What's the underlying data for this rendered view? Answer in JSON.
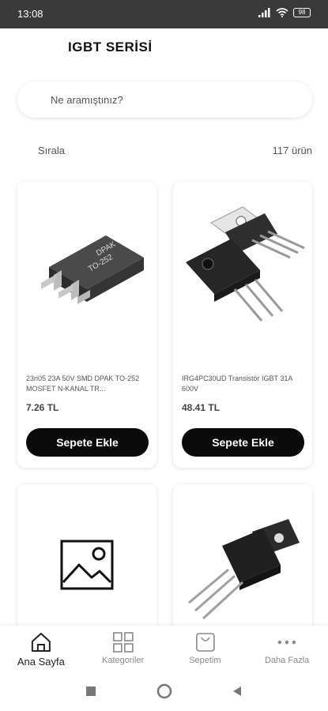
{
  "status": {
    "time": "13:08",
    "battery": "98"
  },
  "header": {
    "title": "IGBT SERİSİ"
  },
  "search": {
    "placeholder": "Ne aramıştınız?"
  },
  "toolbar": {
    "sort_label": "Sırala",
    "count_label": "117 ürün"
  },
  "products": [
    {
      "name": "23n05 23A 50V SMD DPAK TO-252 MOSFET N-KANAL TR...",
      "price": "7.26 TL",
      "button": "Sepete Ekle",
      "image": "dpak-to252-chip",
      "chip_text_1": "DPAK",
      "chip_text_2": "TO-252"
    },
    {
      "name": "IRG4PC30UD Transistör IGBT 31A 600V",
      "price": "48.41 TL",
      "button": "Sepete Ekle",
      "image": "to247-transistor"
    },
    {
      "image": "placeholder-image-icon"
    },
    {
      "image": "to220-transistor"
    }
  ],
  "bottom_nav": [
    {
      "label": "Ana Sayfa",
      "icon": "home-icon",
      "active": true
    },
    {
      "label": "Kategoriler",
      "icon": "grid-icon",
      "active": false
    },
    {
      "label": "Sepetim",
      "icon": "cart-icon",
      "active": false
    },
    {
      "label": "Daha Fazla",
      "icon": "more-icon",
      "active": false
    }
  ]
}
